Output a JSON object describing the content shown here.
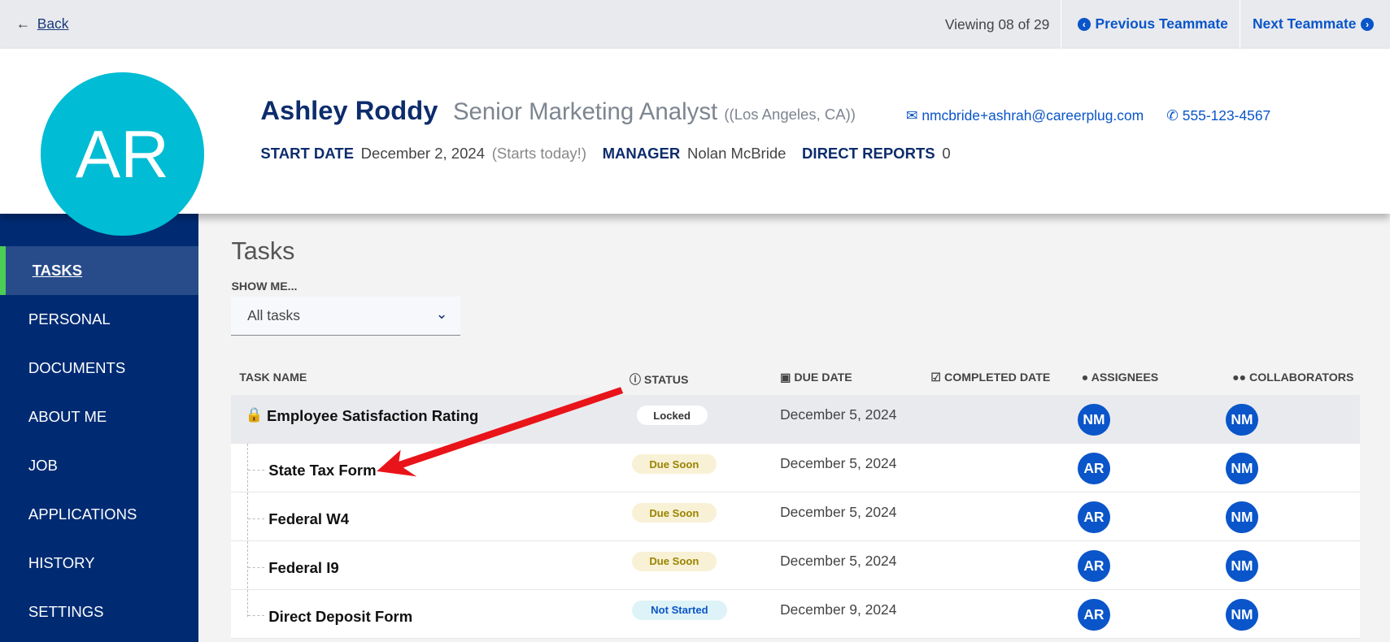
{
  "topbar": {
    "back_label": "Back",
    "viewing": "Viewing 08 of 29",
    "prev_label": "Previous Teammate",
    "next_label": "Next Teammate"
  },
  "profile": {
    "initials": "AR",
    "name": "Ashley Roddy",
    "title": "Senior Marketing Analyst",
    "location": "((Los Angeles, CA))",
    "email": "nmcbride+ashrah@careerplug.com",
    "phone": "555-123-4567",
    "start_label": "START DATE",
    "start_value": "December 2, 2024",
    "start_note": "(Starts today!)",
    "manager_label": "MANAGER",
    "manager_value": "Nolan McBride",
    "reports_label": "DIRECT REPORTS",
    "reports_value": "0",
    "avatar_color": "#00bcd4"
  },
  "sidebar": {
    "items": [
      {
        "label": "TASKS",
        "active": true
      },
      {
        "label": "PERSONAL"
      },
      {
        "label": "DOCUMENTS"
      },
      {
        "label": "ABOUT ME"
      },
      {
        "label": "JOB"
      },
      {
        "label": "APPLICATIONS"
      },
      {
        "label": "HISTORY"
      },
      {
        "label": "SETTINGS"
      }
    ]
  },
  "main": {
    "title": "Tasks",
    "filter_label": "SHOW ME...",
    "filter_value": "All tasks",
    "columns": [
      "TASK NAME",
      "STATUS",
      "DUE DATE",
      "COMPLETED DATE",
      "ASSIGNEES",
      "COLLABORATORS"
    ],
    "rows": [
      {
        "name": "Employee Satisfaction Rating",
        "status": "Locked",
        "due": "December 5, 2024",
        "completed": "",
        "assignee": "NM",
        "collaborator": "NM",
        "locked": true
      },
      {
        "name": "State Tax Form",
        "status": "Due Soon",
        "due": "December 5, 2024",
        "completed": "",
        "assignee": "AR",
        "collaborator": "NM"
      },
      {
        "name": "Federal W4",
        "status": "Due Soon",
        "due": "December 5, 2024",
        "completed": "",
        "assignee": "AR",
        "collaborator": "NM"
      },
      {
        "name": "Federal I9",
        "status": "Due Soon",
        "due": "December 5, 2024",
        "completed": "",
        "assignee": "AR",
        "collaborator": "NM"
      },
      {
        "name": "Direct Deposit Form",
        "status": "Not Started",
        "due": "December 9, 2024",
        "completed": "",
        "assignee": "AR",
        "collaborator": "NM"
      }
    ]
  },
  "colors": {
    "sidebar": "#002b73",
    "accent": "#0a55c9",
    "active_bar": "#4ccd55",
    "annotation_arrow": "#e8141a"
  }
}
